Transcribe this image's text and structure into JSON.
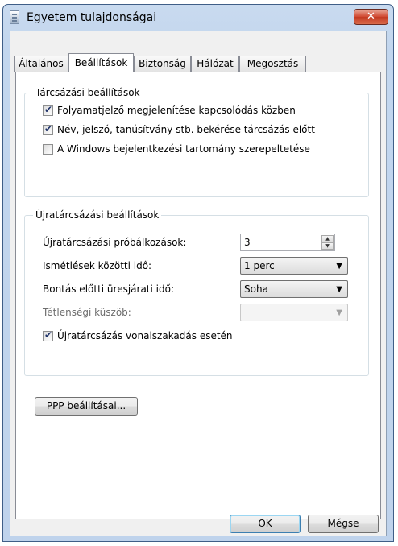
{
  "window": {
    "title": "Egyetem tulajdonságai",
    "close_label": "✕"
  },
  "tabs": [
    {
      "label": "Általános",
      "active": false
    },
    {
      "label": "Beállítások",
      "active": true
    },
    {
      "label": "Biztonság",
      "active": false
    },
    {
      "label": "Hálózat",
      "active": false
    },
    {
      "label": "Megosztás",
      "active": false
    }
  ],
  "dialing": {
    "title": "Tárcsázási beállítások",
    "options": [
      {
        "label": "Folyamatjelző megjelenítése kapcsolódás közben",
        "checked": true
      },
      {
        "label": "Név, jelszó, tanúsítvány stb. bekérése tárcsázás előtt",
        "checked": true
      },
      {
        "label": "A Windows bejelentkezési tartomány szerepeltetése",
        "checked": false
      }
    ]
  },
  "redial": {
    "title": "Újratárcsázási beállítások",
    "attempts_label": "Újratárcsázási próbálkozások:",
    "attempts_value": "3",
    "interval_label": "Ismétlések közötti idő:",
    "interval_value": "1 perc",
    "idle_label": "Bontás előtti üresjárati idő:",
    "idle_value": "Soha",
    "threshold_label": "Tétlenségi küszöb:",
    "threshold_value": "",
    "redial_on_drop_label": "Újratárcsázás vonalszakadás esetén",
    "redial_on_drop_checked": true
  },
  "ppp_button": "PPP beállításai...",
  "footer": {
    "ok": "OK",
    "cancel": "Mégse"
  }
}
